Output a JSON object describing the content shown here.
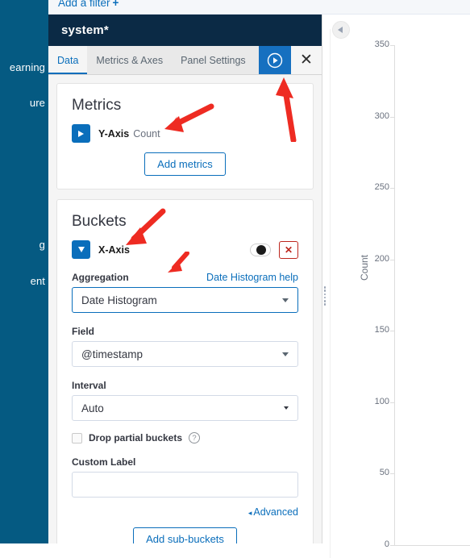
{
  "filter_bar": {
    "add_filter_label": "Add a filter",
    "plus_glyph": "+"
  },
  "app_sidebar": {
    "items": [
      {
        "label": "earning"
      },
      {
        "label": "ure"
      },
      {
        "label": "g"
      },
      {
        "label": "ent"
      }
    ]
  },
  "editor": {
    "title": "system*",
    "tabs": [
      {
        "label": "Data",
        "active": true
      },
      {
        "label": "Metrics & Axes",
        "active": false
      },
      {
        "label": "Panel Settings",
        "active": false
      }
    ],
    "apply_button_label": "Apply changes",
    "close_button_label": "✕",
    "apply_color": "#1670c0",
    "accent_color": "#0a6ebb",
    "header_color": "#0b2a45",
    "danger_color": "#bd271e"
  },
  "metrics": {
    "heading": "Metrics",
    "rows": [
      {
        "axis": "Y-Axis",
        "value": "Count",
        "expanded": false
      }
    ],
    "add_button_label": "Add metrics"
  },
  "buckets": {
    "heading": "Buckets",
    "axis_label": "X-Axis",
    "toggle_name": "enable-bucket-toggle",
    "remove_label": "✕",
    "aggregation": {
      "label": "Aggregation",
      "help_link": "Date Histogram help",
      "value": "Date Histogram"
    },
    "field": {
      "label": "Field",
      "value": "@timestamp"
    },
    "interval": {
      "label": "Interval",
      "value": "Auto"
    },
    "drop_partial": {
      "label": "Drop partial buckets",
      "checked": false,
      "help_glyph": "?"
    },
    "custom_label": {
      "label": "Custom Label",
      "value": "",
      "placeholder": ""
    },
    "advanced_link": "Advanced",
    "advanced_arrow": "◂",
    "add_button_label": "Add sub-buckets"
  },
  "chart_data": {
    "type": "bar",
    "title": "",
    "xlabel": "",
    "ylabel": "Count",
    "ylim": [
      0,
      350
    ],
    "yticks": [
      350,
      300,
      250,
      200,
      150,
      100,
      50,
      0
    ],
    "categories": [],
    "values": [],
    "grid": false,
    "legend": "none",
    "note": "Chart canvas is clipped at the right image edge; only the Y axis with label Count and ticks 0-350 is visible."
  },
  "chart_panel": {
    "collapse_button_label": "Collapse editor"
  },
  "annotations": {
    "arrows": [
      {
        "name": "arrow-to-y-axis-metric"
      },
      {
        "name": "arrow-to-apply-button"
      },
      {
        "name": "arrow-to-x-axis-bucket"
      },
      {
        "name": "arrow-to-aggregation-select"
      }
    ],
    "color": "#ee2b22"
  }
}
